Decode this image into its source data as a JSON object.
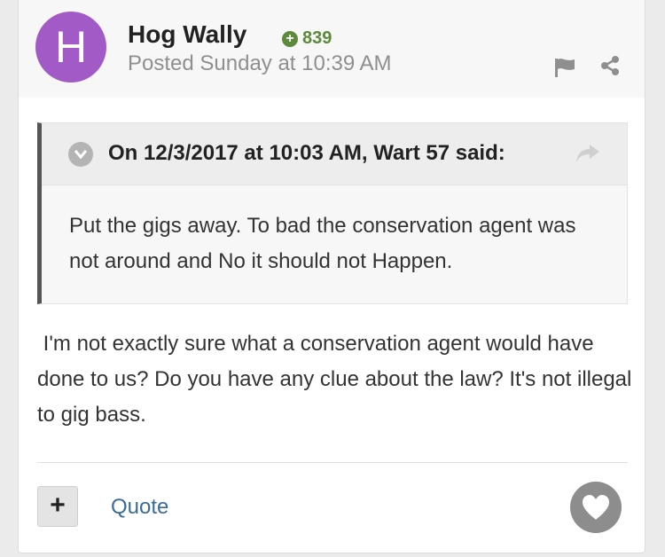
{
  "post": {
    "avatar_letter": "H",
    "avatar_color": "#a25bc6",
    "author": "Hog Wally",
    "reputation": "839",
    "posted": "Posted Sunday at 10:39 AM",
    "quote": {
      "citation": "On 12/3/2017 at 10:03 AM, Wart 57 said:",
      "text": "Put the gigs away. To bad the conservation agent was not around and No it should not Happen."
    },
    "body": " I'm not exactly sure what a conservation agent would have done to us? Do you have any clue about the law? It's not illegal to gig bass.",
    "actions": {
      "plus_label": "+",
      "quote_label": "Quote"
    }
  },
  "colors": {
    "reputation_green": "#5c8a3a",
    "link_blue": "#3a6c98",
    "quote_border": "#555555"
  },
  "icons": {
    "flag": "flag-icon",
    "share": "share-icon",
    "quote_toggle": "chevron-down-icon",
    "quote_share": "reply-arrow-icon",
    "like": "heart-icon",
    "reputation": "plus-circle-icon"
  }
}
